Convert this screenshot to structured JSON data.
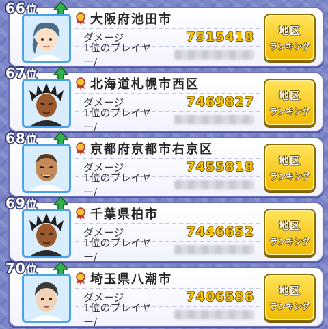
{
  "labels": {
    "damage": "ダメージ",
    "top_player": "1位のプレイヤー/",
    "button_line1": "地区",
    "button_line2": "ランキング",
    "rank_suffix": "位"
  },
  "colors": {
    "card_border": "#6b70b8",
    "damage_value": "#f7c600",
    "button": "#ffd21f",
    "up_arrow": "#2fb34a",
    "avatar_border": "#4aa3e6",
    "background": "#7b86c9"
  },
  "entries": [
    {
      "rank": "66",
      "area": "大阪府池田市",
      "damage": "7515418",
      "icon": "up-arrow-icon",
      "avatar": "blue-haired-boy-avatar"
    },
    {
      "rank": "67",
      "area": "北海道札幌市西区",
      "damage": "7469827",
      "icon": "up-arrow-icon",
      "avatar": "dreadlocks-boy-avatar"
    },
    {
      "rank": "68",
      "area": "京都府京都市右京区",
      "damage": "7455818",
      "icon": "up-arrow-icon",
      "avatar": "bald-man-avatar"
    },
    {
      "rank": "69",
      "area": "千葉県柏市",
      "damage": "7446652",
      "icon": "up-arrow-icon",
      "avatar": "dreadlocks-boy-avatar"
    },
    {
      "rank": "70",
      "area": "埼玉県八潮市",
      "damage": "7406586",
      "icon": "up-arrow-icon",
      "avatar": "dark-haired-boy-avatar"
    }
  ]
}
